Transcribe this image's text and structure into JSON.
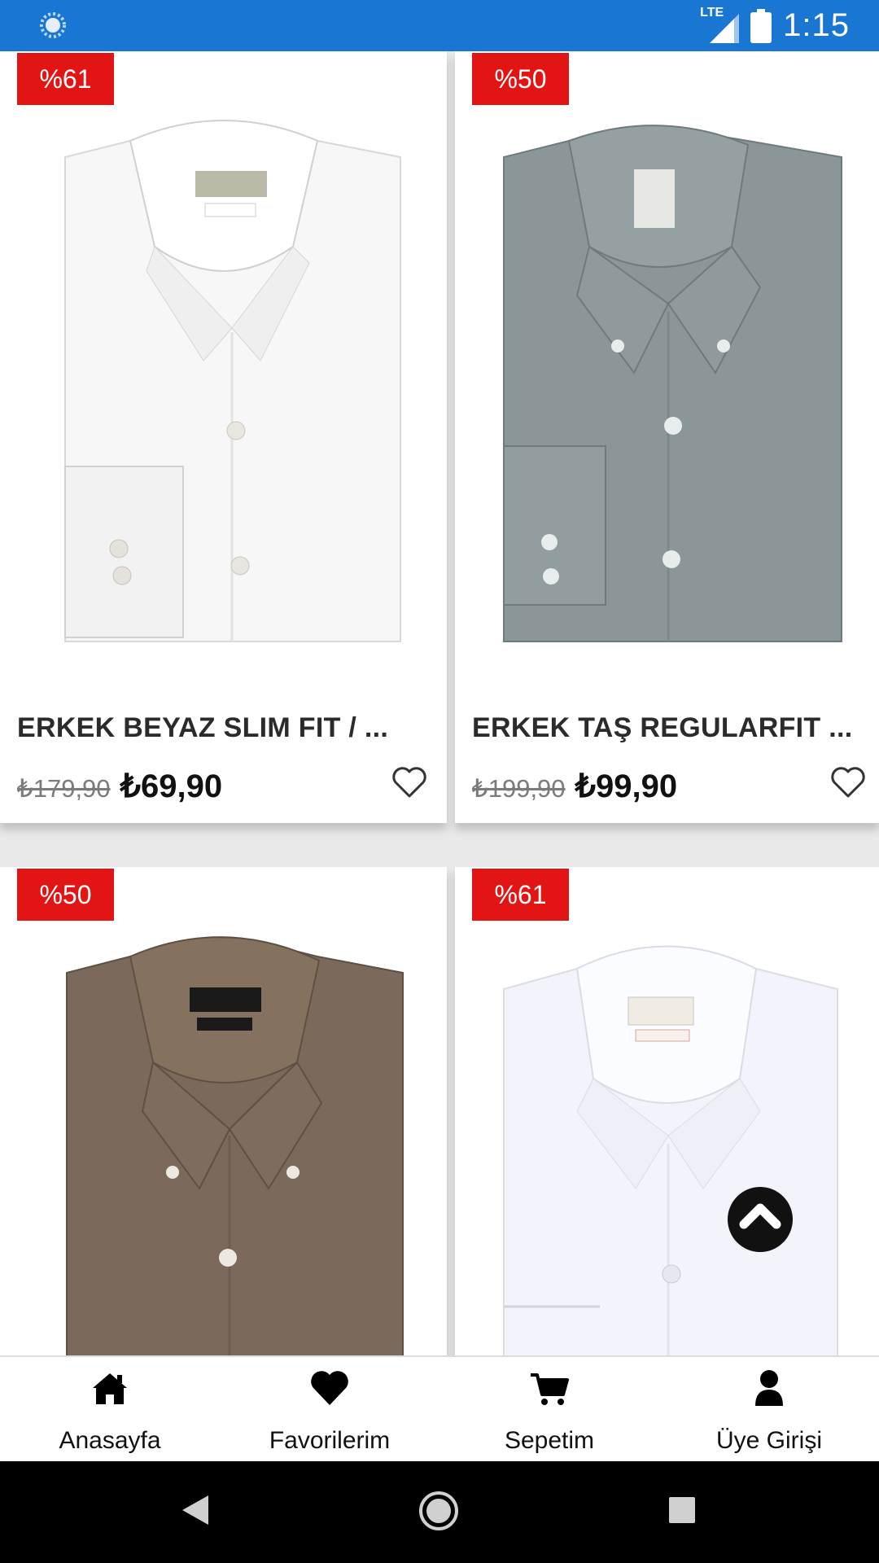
{
  "status_bar": {
    "network": "LTE",
    "time": "1:15",
    "icons": [
      "loading-icon",
      "lte-signal-icon",
      "battery-icon"
    ]
  },
  "products": [
    {
      "discount": "%61",
      "title": "ERKEK BEYAZ SLIM FIT / ...",
      "old_price": "₺179,90",
      "price": "₺69,90",
      "shirt_color": "#f7f7f7"
    },
    {
      "discount": "%50",
      "title": "ERKEK TAŞ REGULARFIT ...",
      "old_price": "₺199,90",
      "price": "₺99,90",
      "shirt_color": "#8b9699"
    },
    {
      "discount": "%50",
      "shirt_color": "#7b6a5c"
    },
    {
      "discount": "%61",
      "shirt_color": "#f3f4fb"
    }
  ],
  "bottom_nav": [
    {
      "label": "Anasayfa",
      "icon": "home-icon"
    },
    {
      "label": "Favorilerim",
      "icon": "heart-icon"
    },
    {
      "label": "Sepetim",
      "icon": "cart-icon"
    },
    {
      "label": "Üye Girişi",
      "icon": "user-icon"
    }
  ],
  "system_nav": [
    "back-icon",
    "home-circle-icon",
    "recents-icon"
  ],
  "colors": {
    "status_bar": "#1976d2",
    "badge": "#e31414"
  }
}
